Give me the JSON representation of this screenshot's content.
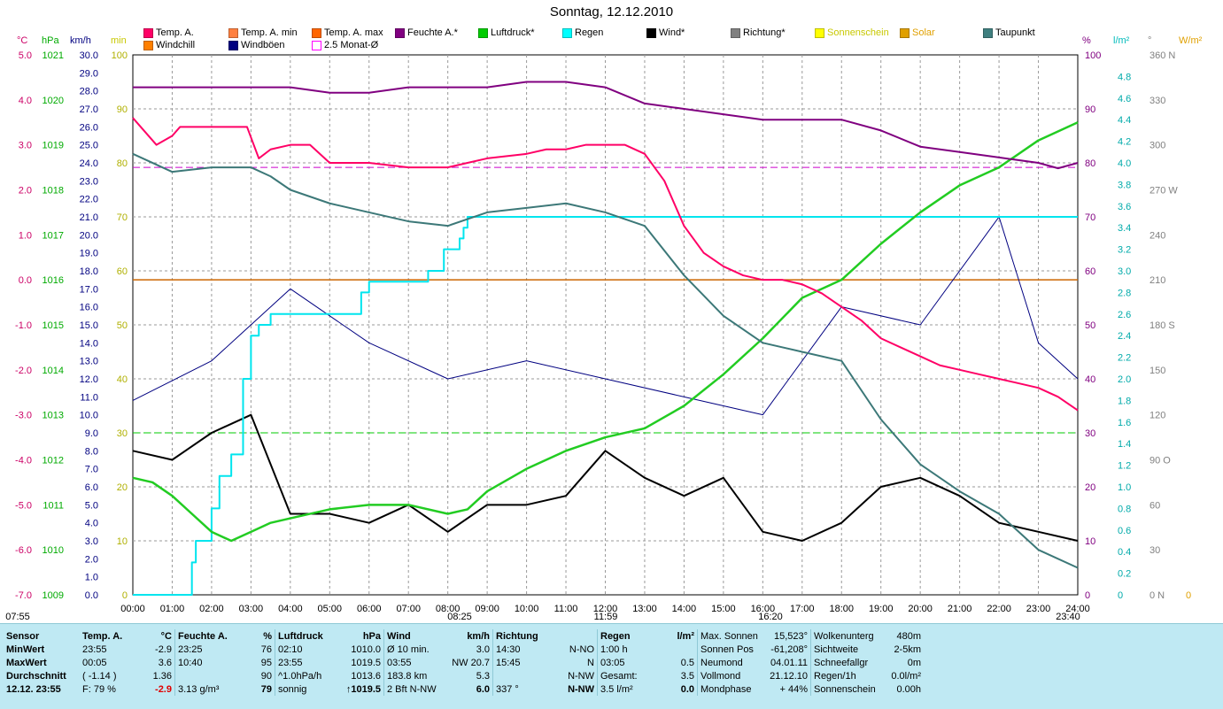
{
  "title": "Sonntag, 12.12.2010",
  "legend": [
    {
      "label": "Temp. A.",
      "color": "#ff0066"
    },
    {
      "label": "Windchill",
      "color": "#ff8000"
    },
    {
      "label": "Temp. A. min",
      "color": "#ff8040"
    },
    {
      "label": "Windböen",
      "color": "#000080"
    },
    {
      "label": "Temp. A. max",
      "color": "#ff6600"
    },
    {
      "label": "2.5 Monat-Ø",
      "color": "#ff00ff"
    },
    {
      "label": "Feuchte A.*",
      "color": "#800080"
    },
    {
      "label": "Luftdruck*",
      "color": "#00cc00"
    },
    {
      "label": "Regen",
      "color": "#00ffff"
    },
    {
      "label": "Wind*",
      "color": "#000000"
    },
    {
      "label": "Richtung*",
      "color": "#808080"
    },
    {
      "label": "Sonnenschein",
      "color": "#ffff00"
    },
    {
      "label": "Solar",
      "color": "#e0a000"
    },
    {
      "label": "Taupunkt",
      "color": "#408080"
    }
  ],
  "units": {
    "temp": "°C",
    "press": "hPa",
    "wind": "km/h",
    "min": "min",
    "hum": "%",
    "rain": "l/m²",
    "dir": "°",
    "solar": "W/m²"
  },
  "axes": {
    "temp_ticks": [
      "5.0",
      "4.0",
      "3.0",
      "2.0",
      "1.0",
      "0.0",
      "-1.0",
      "-2.0",
      "-3.0",
      "-4.0",
      "-5.0",
      "-6.0",
      "-7.0"
    ],
    "press_ticks": [
      "1021",
      "1020",
      "1019",
      "1018",
      "1017",
      "1016",
      "1015",
      "1014",
      "1013",
      "1012",
      "1011",
      "1010",
      "1009"
    ],
    "wind_ticks": [
      "30.0",
      "29.0",
      "28.0",
      "27.0",
      "26.0",
      "25.0",
      "24.0",
      "23.0",
      "22.0",
      "21.0",
      "20.0",
      "19.0",
      "18.0",
      "17.0",
      "16.0",
      "15.0",
      "14.0",
      "13.0",
      "12.0",
      "11.0",
      "10.0",
      "9.0",
      "8.0",
      "7.0",
      "6.0",
      "5.0",
      "4.0",
      "3.0",
      "2.0",
      "1.0",
      "0.0"
    ],
    "min_ticks": [
      "100",
      "90",
      "80",
      "70",
      "60",
      "50",
      "40",
      "30",
      "20",
      "10",
      "0"
    ],
    "hum_ticks": [
      "100",
      "90",
      "80",
      "70",
      "60",
      "50",
      "40",
      "30",
      "20",
      "10",
      "0"
    ],
    "rain_ticks": [
      "4.8",
      "4.6",
      "4.4",
      "4.2",
      "4.0",
      "3.8",
      "3.6",
      "3.4",
      "3.2",
      "3.0",
      "2.8",
      "2.6",
      "2.4",
      "2.2",
      "2.0",
      "1.8",
      "1.6",
      "1.4",
      "1.2",
      "1.0",
      "0.8",
      "0.6",
      "0.4",
      "0.2",
      "0"
    ],
    "dir_ticks": [
      "360 N",
      "330",
      "300",
      "270 W",
      "240",
      "210",
      "180 S",
      "150",
      "120",
      "90 O",
      "60",
      "30",
      "0 N"
    ],
    "solar_tick": "0",
    "time_ticks": [
      "00:00",
      "01:00",
      "02:00",
      "03:00",
      "04:00",
      "05:00",
      "06:00",
      "07:00",
      "08:00",
      "09:00",
      "10:00",
      "11:00",
      "12:00",
      "13:00",
      "14:00",
      "15:00",
      "16:00",
      "17:00",
      "18:00",
      "19:00",
      "20:00",
      "21:00",
      "22:00",
      "23:00",
      "24:00"
    ],
    "sun_marks": [
      "07:55",
      "08:25",
      "11:59",
      "16:20",
      "23:40"
    ]
  },
  "chart_data": {
    "type": "line",
    "title": "Sonntag, 12.12.2010",
    "x_unit": "hour",
    "xlim": [
      0,
      24
    ],
    "ylim_temp": [
      -7,
      5
    ],
    "ylim_pressure": [
      1009,
      1021
    ],
    "ylim_wind": [
      0,
      30
    ],
    "ylim_humidity": [
      0,
      100
    ],
    "ylim_rain": [
      0,
      5
    ],
    "grid": true,
    "series": [
      {
        "name": "Temp. A.",
        "unit": "°C",
        "x": [
          0,
          0.3,
          0.6,
          1,
          1.2,
          1.5,
          2,
          2.5,
          2.9,
          3.2,
          3.5,
          4,
          4.5,
          5,
          5.5,
          6,
          7,
          8,
          8.5,
          9,
          10,
          10.5,
          11,
          11.5,
          12,
          12.5,
          13,
          13.5,
          14,
          14.5,
          15,
          15.5,
          16,
          16.5,
          17,
          17.5,
          18,
          18.5,
          19,
          19.5,
          20,
          20.5,
          21,
          21.5,
          22,
          22.5,
          23,
          23.5,
          24
        ],
        "y": [
          3.6,
          3.3,
          3.0,
          3.2,
          3.4,
          3.4,
          3.4,
          3.4,
          3.4,
          2.7,
          2.9,
          3.0,
          3.0,
          2.6,
          2.6,
          2.6,
          2.5,
          2.5,
          2.6,
          2.7,
          2.8,
          2.9,
          2.9,
          3.0,
          3.0,
          3.0,
          2.8,
          2.2,
          1.2,
          0.6,
          0.3,
          0.1,
          0.0,
          0.0,
          -0.1,
          -0.3,
          -0.6,
          -0.9,
          -1.3,
          -1.5,
          -1.7,
          -1.9,
          -2.0,
          -2.1,
          -2.2,
          -2.3,
          -2.4,
          -2.6,
          -2.9
        ]
      },
      {
        "name": "Feuchte A.*",
        "unit": "%",
        "x": [
          0,
          1,
          2,
          3,
          4,
          5,
          6,
          7,
          8,
          9,
          10,
          11,
          12,
          13,
          14,
          15,
          16,
          17,
          18,
          19,
          20,
          21,
          22,
          23,
          23.5,
          24
        ],
        "y": [
          94,
          94,
          94,
          94,
          94,
          93,
          93,
          94,
          94,
          94,
          95,
          95,
          94,
          91,
          90,
          89,
          88,
          88,
          88,
          86,
          83,
          82,
          81,
          80,
          79,
          80
        ]
      },
      {
        "name": "Luftdruck*",
        "unit": "hPa",
        "x": [
          0,
          0.5,
          1,
          1.5,
          2,
          2.5,
          3,
          3.5,
          4,
          5,
          6,
          7,
          8,
          8.5,
          9,
          10,
          11,
          12,
          13,
          14,
          15,
          16,
          17,
          18,
          19,
          20,
          21,
          22,
          23,
          24
        ],
        "y": [
          1011.6,
          1011.5,
          1011.2,
          1010.8,
          1010.4,
          1010.2,
          1010.4,
          1010.6,
          1010.7,
          1010.9,
          1011.0,
          1011.0,
          1010.8,
          1010.9,
          1011.3,
          1011.8,
          1012.2,
          1012.5,
          1012.7,
          1013.2,
          1013.9,
          1014.7,
          1015.6,
          1016.0,
          1016.8,
          1017.5,
          1018.1,
          1018.5,
          1019.1,
          1019.5
        ]
      },
      {
        "name": "Regen",
        "unit": "l/m²",
        "x": [
          0,
          1,
          1.5,
          1.6,
          2.0,
          2.2,
          2.5,
          2.8,
          3.0,
          3.2,
          3.5,
          4.0,
          5.0,
          5.8,
          6.0,
          7.0,
          7.5,
          7.9,
          8.2,
          8.3,
          8.4,
          8.5,
          9,
          24
        ],
        "y": [
          0,
          0,
          0.3,
          0.5,
          0.8,
          1.1,
          1.3,
          2.0,
          2.4,
          2.5,
          2.6,
          2.6,
          2.6,
          2.8,
          2.9,
          2.9,
          3.0,
          3.2,
          3.2,
          3.3,
          3.4,
          3.5,
          3.5,
          3.5
        ]
      },
      {
        "name": "Taupunkt",
        "unit": "°C",
        "x": [
          0,
          1,
          2,
          3,
          3.5,
          4,
          5,
          6,
          7,
          8,
          9,
          10,
          11,
          12,
          13,
          14,
          15,
          16,
          17,
          18,
          19,
          20,
          21,
          22,
          23,
          24
        ],
        "y": [
          2.8,
          2.4,
          2.5,
          2.5,
          2.3,
          2.0,
          1.7,
          1.5,
          1.3,
          1.2,
          1.5,
          1.6,
          1.7,
          1.5,
          1.2,
          0.1,
          -0.8,
          -1.4,
          -1.6,
          -1.8,
          -3.1,
          -4.1,
          -4.7,
          -5.2,
          -6.0,
          -6.4
        ]
      },
      {
        "name": "Wind*",
        "unit": "km/h",
        "x": [
          0,
          1,
          2,
          3,
          4,
          5,
          6,
          7,
          8,
          9,
          10,
          11,
          12,
          13,
          14,
          15,
          16,
          17,
          18,
          19,
          20,
          21,
          22,
          23,
          24
        ],
        "y": [
          8.0,
          7.5,
          9.0,
          10.0,
          4.5,
          4.5,
          4.0,
          5.0,
          3.5,
          5.0,
          5.0,
          5.5,
          8.0,
          6.5,
          5.5,
          6.5,
          3.5,
          3.0,
          4.0,
          6.0,
          6.5,
          5.5,
          4.0,
          3.5,
          3.0
        ]
      },
      {
        "name": "Windböen",
        "unit": "km/h",
        "x": [
          0,
          2,
          4,
          6,
          8,
          10,
          12,
          14,
          16,
          18,
          20,
          22,
          23,
          24
        ],
        "y": [
          10.8,
          13.0,
          17.0,
          14.0,
          12.0,
          13.0,
          12.0,
          11.0,
          10.0,
          16.0,
          15.0,
          21.0,
          14.0,
          12.0
        ]
      }
    ],
    "reference_lines": [
      {
        "name": "2.5 Monat-Ø",
        "unit": "°C",
        "value": 2.5
      },
      {
        "name": "Temp. A. mean",
        "unit": "°C",
        "value": -0.0
      },
      {
        "name": "Luftdruck mean",
        "unit": "hPa",
        "value": 1012.6
      },
      {
        "name": "Regen total",
        "unit": "l/m²",
        "value": 3.5
      }
    ]
  },
  "info": {
    "h_sensor": "Sensor",
    "h_temp": "Temp. A.",
    "u_temp": "°C",
    "h_hum": "Feuchte A.",
    "u_hum": "%",
    "h_press": "Luftdruck",
    "u_press": "hPa",
    "h_wind": "Wind",
    "u_wind": "km/h",
    "h_dir": "Richtung",
    "h_rain": "Regen",
    "u_rain": "l/m²",
    "r_min": "MinWert",
    "r_max": "MaxWert",
    "r_avg": "Durchschnitt",
    "r_now": "12.12. 23:55",
    "tmin_t": "23:55",
    "tmin_v": "-2.9",
    "tmax_t": "00:05",
    "tmax_v": "3.6",
    "tavg_a": "( -1.14 )",
    "tavg_v": "1.36",
    "tnow_f": "F: 79 %",
    "tnow_v": "-2.9",
    "hmin_t": "23:25",
    "hmin_v": "76",
    "hmax_t": "10:40",
    "hmax_v": "95",
    "havg_v": "90",
    "hnow_a": "3.13 g/m³",
    "hnow_v": "79",
    "pmin_t": "02:10",
    "pmin_v": "1010.0",
    "pmax_t": "23:55",
    "pmax_v": "1019.5",
    "pavg_a": "^1.0hPa/h",
    "pavg_v": "1013.6",
    "pnow_a": "sonnig",
    "pnow_v": "↑1019.5",
    "w1_a": "Ø 10 min.",
    "w1_v": "3.0",
    "w2_a": "03:55",
    "w2_b": "NW 20.7",
    "w3_a": "183.8 km",
    "w3_v": "5.3",
    "w4_a": "2 Bft N-NW",
    "w4_v": "6.0",
    "d1_t": "14:30",
    "d1_v": "N-NO",
    "d2_t": "15:45",
    "d2_v": "N",
    "d3_v": "N-NW",
    "d4_a": "337 °",
    "d4_v": "N-NW",
    "r1_a": "1:00 h",
    "r1_v": "",
    "r2_a": "03:05",
    "r2_v": "0.5",
    "r3_a": "Gesamt:",
    "r3_v": "3.5",
    "r4_a": "3.5 l/m²",
    "r4_v": "0.0",
    "s1_a": "Max. Sonnen",
    "s1_v": "15,523°",
    "s2_a": "Sonnen Pos",
    "s2_v": "-61,208°",
    "s3_a": "Neumond",
    "s3_v": "04.01.11",
    "s4_a": "Vollmond",
    "s4_v": "21.12.10",
    "s5_a": "Mondphase",
    "s5_v": "+ 44%",
    "c1_a": "Wolkenunterg",
    "c1_v": "480m",
    "c2_a": "Sichtweite",
    "c2_v": "2-5km",
    "c3_a": "Schneefallgr",
    "c3_v": "0m",
    "c4_a": "Regen/1h",
    "c4_v": "0.0l/m²",
    "c5_a": "Sonnenschein",
    "c5_v": "0.00h"
  }
}
